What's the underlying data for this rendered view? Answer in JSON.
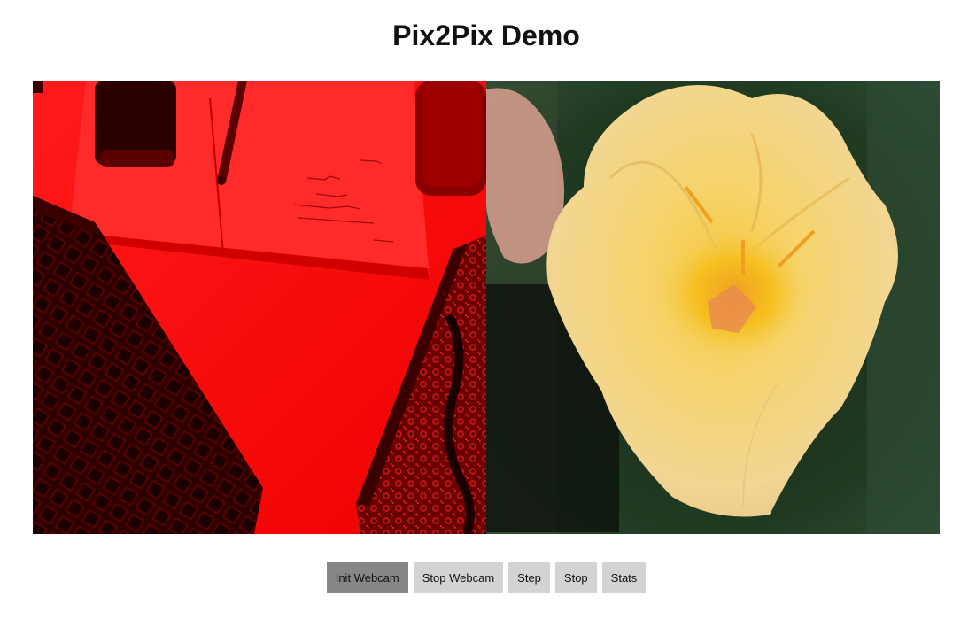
{
  "page": {
    "title": "Pix2Pix Demo"
  },
  "panels": {
    "input": {
      "icon": "webcam-input-image",
      "tint": "#ff0000"
    },
    "output": {
      "icon": "generated-flower-image",
      "accent": "#f6d36a"
    }
  },
  "controls": {
    "init_webcam": "Init Webcam",
    "stop_webcam": "Stop Webcam",
    "step": "Step",
    "stop": "Stop",
    "stats": "Stats"
  },
  "colors": {
    "button": "#d3d3d3",
    "button_active": "#878787"
  }
}
